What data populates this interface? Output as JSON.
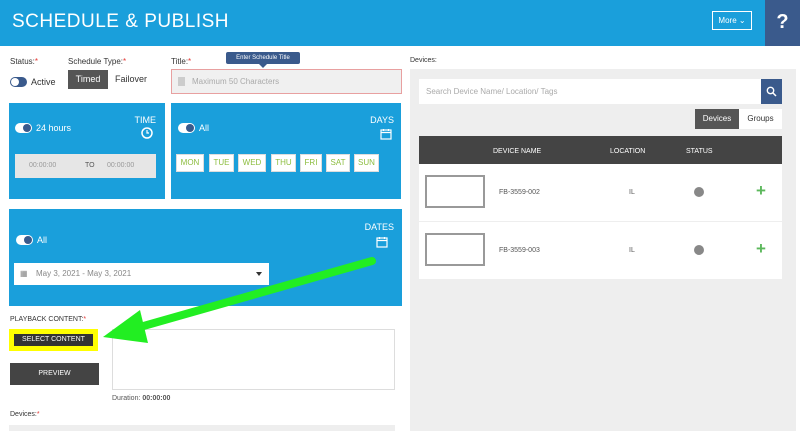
{
  "header": {
    "title": "SCHEDULE & PUBLISH",
    "more_label": "More ⌄",
    "help_label": "?"
  },
  "status": {
    "label": "Status:",
    "req": "*",
    "value": "Active"
  },
  "schedule_type": {
    "label": "Schedule Type:",
    "req": "*",
    "options": [
      "Timed",
      "Failover"
    ],
    "selected": "Timed"
  },
  "title_field": {
    "label": "Title:",
    "req": "*",
    "tooltip": "Enter Schedule Title",
    "placeholder": "Maximum 50 Characters"
  },
  "time_panel": {
    "title": "TIME",
    "toggle_label": "24 hours",
    "start": "00:00:00",
    "to": "TO",
    "end": "00:00:00"
  },
  "days_panel": {
    "title": "DAYS",
    "toggle_label": "All",
    "days": [
      "MON",
      "TUE",
      "WED",
      "THU",
      "FRI",
      "SAT",
      "SUN"
    ]
  },
  "dates_panel": {
    "title": "DATES",
    "toggle_label": "All",
    "range": "May 3, 2021 - May 3, 2021"
  },
  "playback": {
    "label": "PLAYBACK CONTENT:",
    "req": "*",
    "select_label": "SELECT CONTENT",
    "preview_label": "PREVIEW",
    "duration_label": "Duration:",
    "duration_value": "00:00:00"
  },
  "devices_bottom": {
    "label": "Devices:",
    "req": "*"
  },
  "devices_panel": {
    "label": "Devices:",
    "search_placeholder": "Search Device Name/ Location/ Tags",
    "tabs": [
      "Devices",
      "Groups"
    ],
    "selected_tab": "Devices",
    "columns": [
      "DEVICE NAME",
      "LOCATION",
      "STATUS"
    ],
    "rows": [
      {
        "name": "FB-3559-002",
        "location": "IL"
      },
      {
        "name": "FB-3559-003",
        "location": "IL"
      }
    ]
  },
  "colors": {
    "header": "#1a9fdb",
    "help": "#3a5a8c",
    "annotation_arrow": "#22ee22",
    "highlight": "#ffff00"
  }
}
